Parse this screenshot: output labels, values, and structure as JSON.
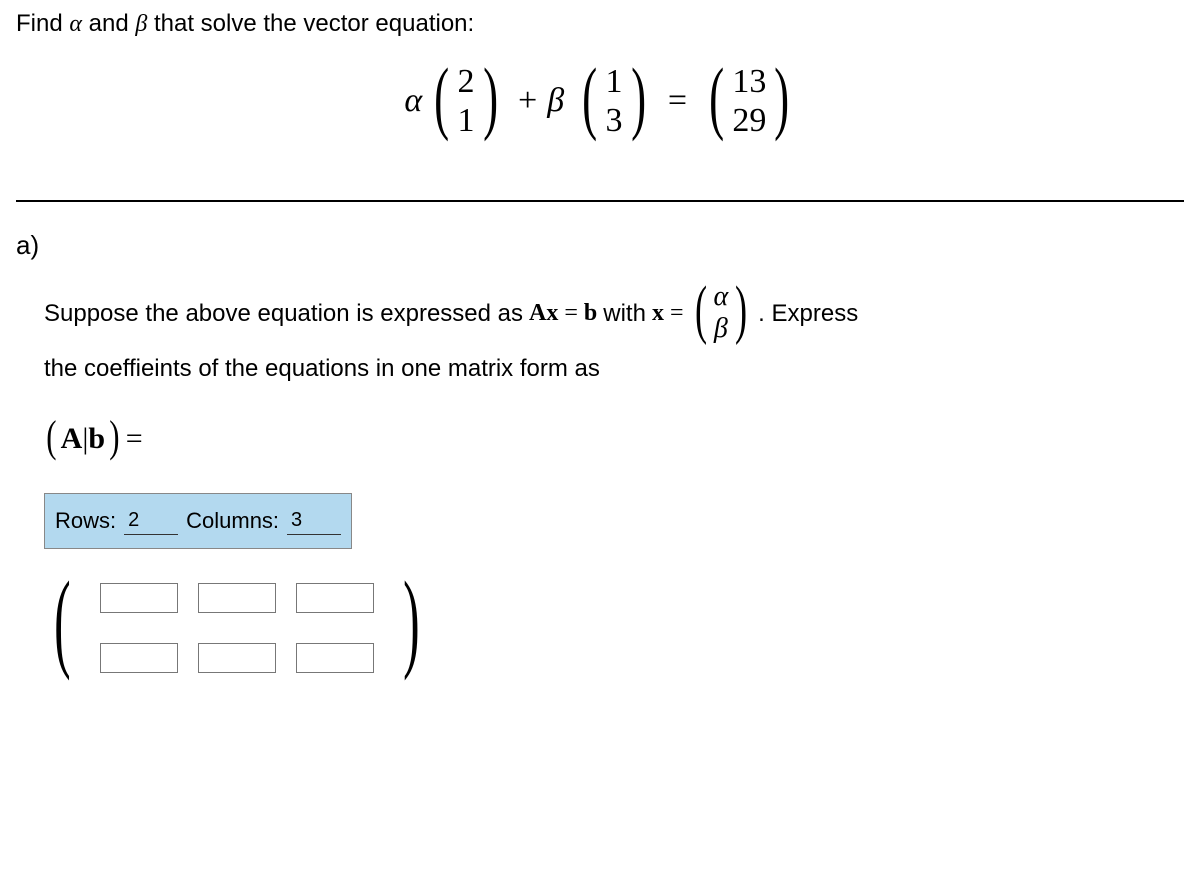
{
  "prompt": {
    "prefix": "Find ",
    "alpha": "α",
    "mid": " and ",
    "beta": "β",
    "suffix": " that solve the vector equation:"
  },
  "equation": {
    "alpha": "α",
    "v1_top": "2",
    "v1_bot": "1",
    "plus_beta": "+ β",
    "v2_top": "1",
    "v2_bot": "3",
    "eq": "=",
    "v3_top": "13",
    "v3_bot": "29"
  },
  "part_label": "a)",
  "body": {
    "line1_a": "Suppose the above equation is expressed as ",
    "axb": "Ax = b",
    "with": " with ",
    "x_eq": "x =",
    "xvec_top": "α",
    "xvec_bot": "β",
    "period_express": ". Express",
    "line2": "the coeffieints  of the equations in one matrix form as",
    "ab_left": "(",
    "ab_A": "A",
    "ab_bar": "|",
    "ab_b": "b",
    "ab_right": ")",
    "ab_eq": "="
  },
  "controls": {
    "rows_label": "Rows:",
    "rows_value": "2",
    "cols_label": "Columns:",
    "cols_value": "3"
  },
  "matrix": {
    "rows": 2,
    "cols": 3
  }
}
